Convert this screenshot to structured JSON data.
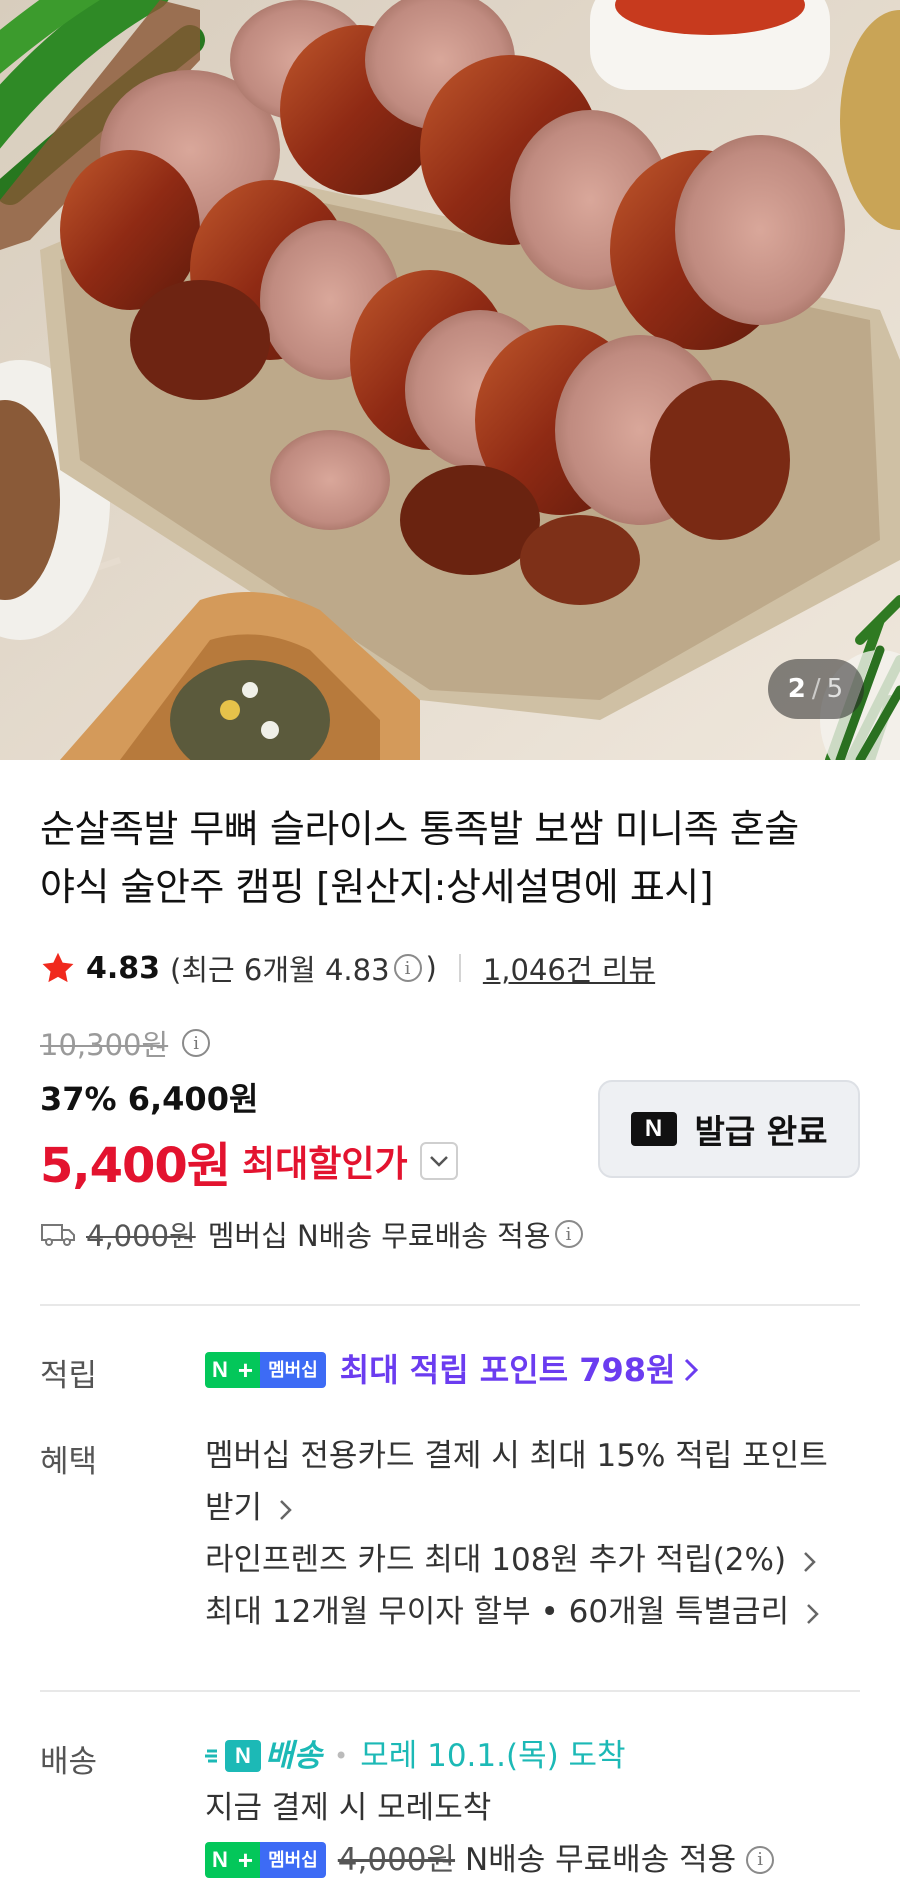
{
  "hero": {
    "image_name": "pork-hock-platter-photo",
    "counter": {
      "current": "2",
      "separator": "/",
      "total": "5"
    }
  },
  "product": {
    "title_line1": "순살족발 무뼈 슬라이스 통족발 보쌈 미니족 혼술",
    "title_line2": "야식 술안주 캠핑 [원산지:상세설명에 표시]"
  },
  "rating": {
    "score": "4.83",
    "recent_prefix": "(최근 6개월 4.83",
    "recent_suffix": ")",
    "review_count": "1,046건 리뷰"
  },
  "price": {
    "original": "10,300원",
    "discount_line": "37% 6,400원",
    "final": "5,400원",
    "final_label": "최대할인가",
    "coupon_button": "발급 완료",
    "coupon_logo": "N"
  },
  "shipping_summary": {
    "original_fee": "4,000원",
    "text": "멤버십 N배송 무료배송 적용"
  },
  "benefits": {
    "points_label": "적립",
    "badge_n": "N",
    "badge_plus": "+",
    "badge_member": "멤버십",
    "points_text": "최대 적립 포인트 798원",
    "benefit_label": "혜택",
    "benefit_line1": "멤버십 전용카드 결제 시 최대 15% 적립 포인트",
    "benefit_line1b": "받기",
    "benefit_line2": "라인프렌즈 카드 최대 108원 추가 적립(2%)",
    "benefit_line3": "최대 12개월 무이자 할부 • 60개월 특별금리"
  },
  "delivery": {
    "label": "배송",
    "service_logo": "N",
    "service_name": "배송",
    "arrival": "모레 10.1.(목) 도착",
    "note": "지금 결제 시 모레도착",
    "original_fee": "4,000원",
    "free_text": "N배송 무료배송 적용"
  },
  "colors": {
    "accent_red": "#e3132f",
    "point_purple": "#6b3cf0",
    "naver_green": "#03c75a",
    "member_blue": "#3d6bf5",
    "delivery_teal": "#1cb9b6",
    "star": "#f0291d"
  }
}
